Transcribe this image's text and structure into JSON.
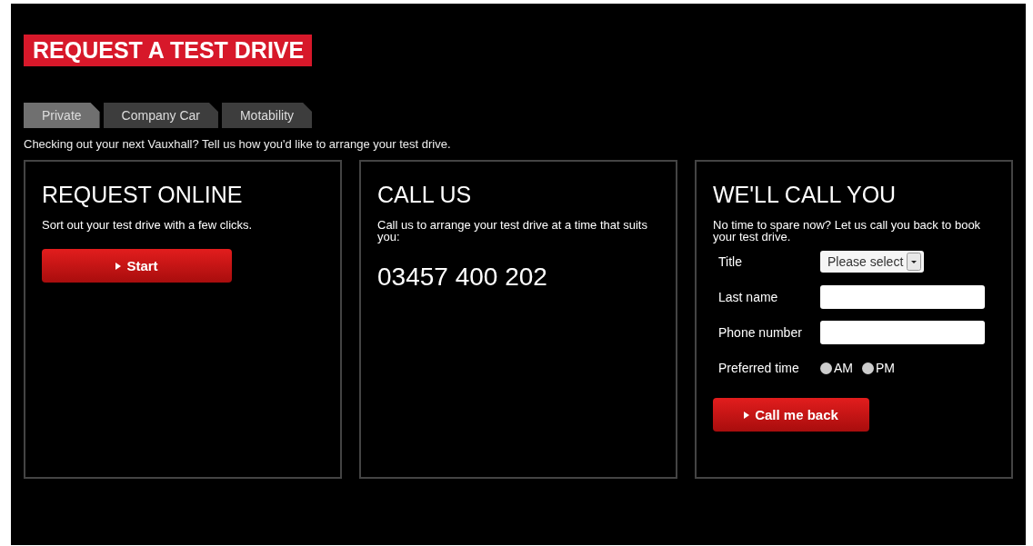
{
  "heading": "REQUEST A TEST DRIVE",
  "tabs": [
    {
      "label": "Private",
      "selected": true
    },
    {
      "label": "Company Car",
      "selected": false
    },
    {
      "label": "Motability",
      "selected": false
    }
  ],
  "intro": "Checking out your next Vauxhall? Tell us how you'd like to arrange your test drive.",
  "panels": [
    {
      "kind": "online",
      "title": "REQUEST ONLINE",
      "text": "Sort out your test drive with a few clicks.",
      "button": "Start"
    },
    {
      "kind": "call",
      "title": "CALL US",
      "text": "Call us to arrange your test drive at a time that suits you:",
      "phone": "03457 400 202"
    },
    {
      "kind": "callback",
      "title": "WE'LL CALL YOU",
      "text": "No time to spare now? Let us call you back to book your test drive.",
      "fields": [
        {
          "kind": "select",
          "label": "Title",
          "value": "Please select"
        },
        {
          "kind": "text",
          "label": "Last name"
        },
        {
          "kind": "text",
          "label": "Phone number"
        },
        {
          "kind": "radio",
          "label": "Preferred time",
          "options": [
            {
              "label": "AM",
              "selected": false
            },
            {
              "label": "PM",
              "selected": false
            }
          ]
        }
      ],
      "button": "Call me back"
    }
  ]
}
